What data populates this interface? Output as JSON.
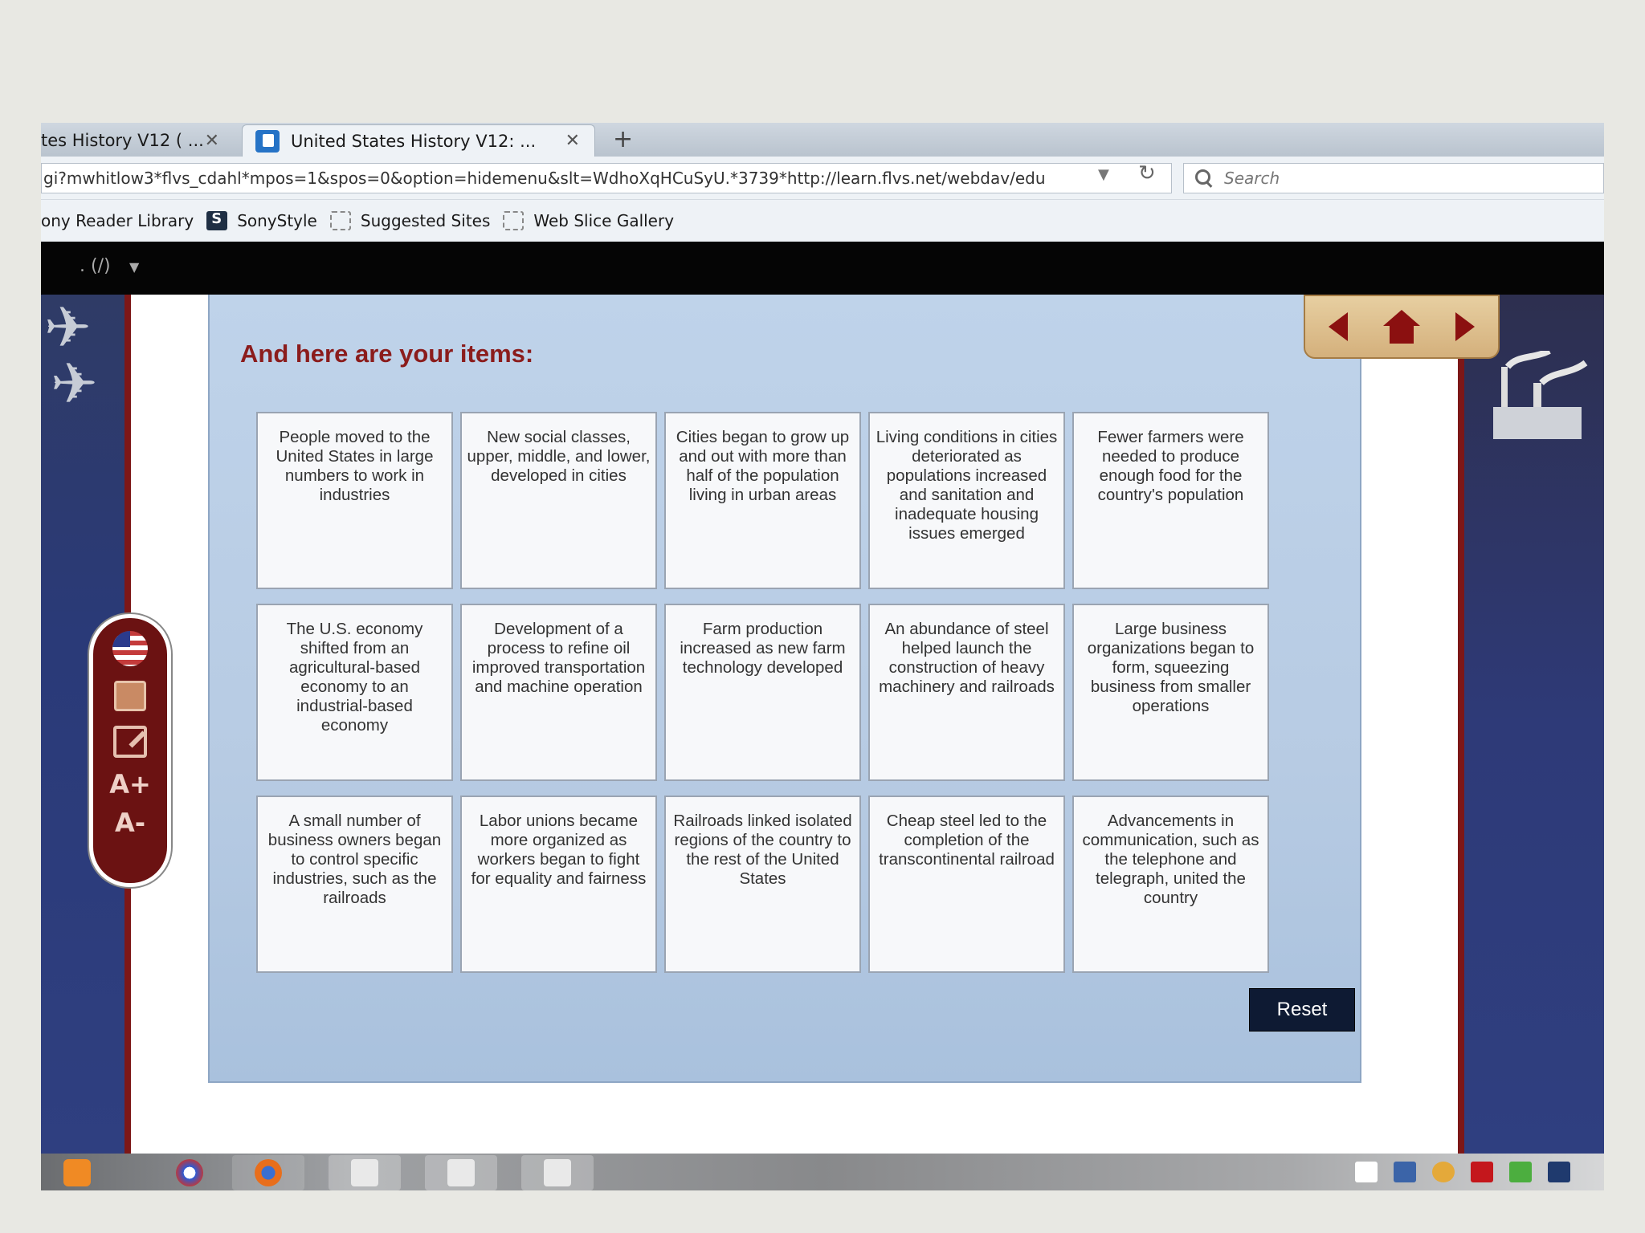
{
  "browser": {
    "tabs": [
      {
        "label": "tes History V12 ( ...",
        "active": false
      },
      {
        "label": "United States History V12: ...",
        "active": true
      }
    ],
    "new_tab": "+",
    "close_glyph": "✕",
    "url": "gi?mwhitlow3*flvs_cdahl*mpos=1&spos=0&option=hidemenu&slt=WdhoXqHCuSyU.*3739*http://learn.flvs.net/webdav/edu",
    "search_placeholder": "Search",
    "bookmarks": [
      "ony Reader Library",
      "SonyStyle",
      "Suggested Sites",
      "Web Slice Gallery"
    ]
  },
  "app_toolbar": {
    "label": ". (/)"
  },
  "panel": {
    "title": "And here are your items:",
    "items": [
      "People moved to the United States in large numbers to work in industries",
      "New social classes, upper, middle, and lower, developed in cities",
      "Cities began to grow up and out with more than half of the population living in urban areas",
      "Living conditions in cities deteriorated as populations increased and sanitation and inadequate housing issues emerged",
      "Fewer farmers were needed to produce enough food for the country's population",
      "The U.S. economy shifted from an agricultural-based economy to an industrial-based economy",
      "Development of a process to refine oil improved transportation and machine operation",
      "Farm production increased as new farm technology developed",
      "An abundance of steel helped launch the construction of heavy machinery and railroads",
      "Large business organizations began to form, squeezing business from smaller operations",
      "A small number of business owners began to control specific industries, such as the railroads",
      "Labor unions became more organized as workers began to fight for equality and fairness",
      "Railroads linked isolated regions of the country to the rest of the United States",
      "Cheap steel led to the completion of the transcontinental railroad",
      "Advancements in communication, such as the telephone and telegraph, united the country"
    ],
    "reset_label": "Reset"
  },
  "sidetools": {
    "font_increase": "A+",
    "font_decrease": "A-"
  },
  "colors": {
    "accent": "#8b1c1c",
    "panel_bg": "#bfd3ea",
    "reset_bg": "#0e1a33"
  }
}
